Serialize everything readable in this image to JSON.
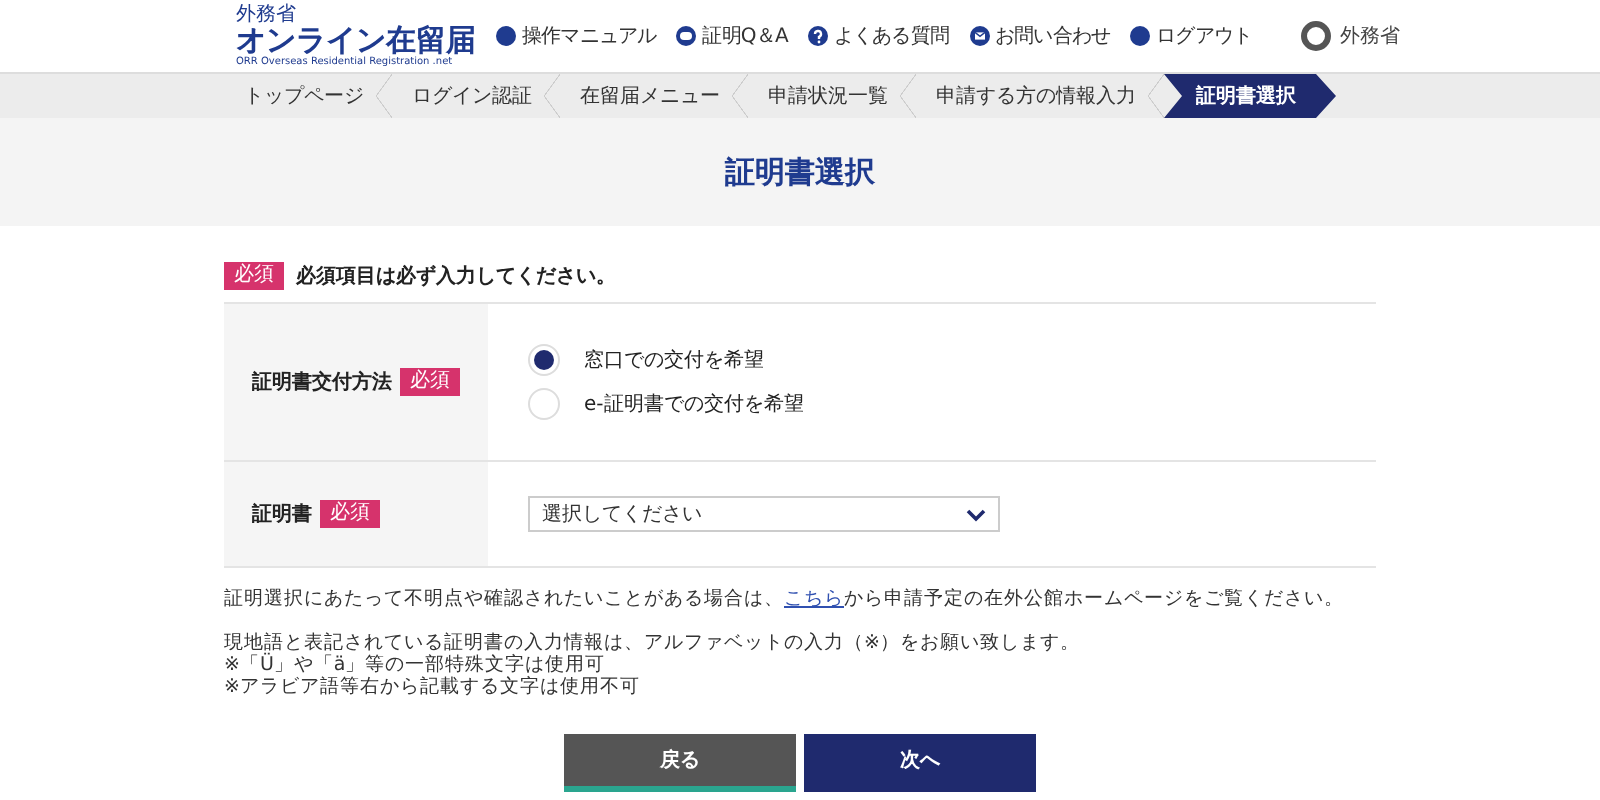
{
  "header": {
    "logo": {
      "top": "外務省",
      "main": "オンライン在留届",
      "sub": "ORR Overseas Residential Registration .net"
    },
    "links": [
      {
        "label": "操作マニュアル",
        "kind": "dot"
      },
      {
        "label": "証明Q＆A",
        "kind": "qa"
      },
      {
        "label": "よくある質問",
        "kind": "help"
      },
      {
        "label": "お問い合わせ",
        "kind": "mail"
      },
      {
        "label": "ログアウト",
        "kind": "dot"
      }
    ],
    "ministry": "外務省"
  },
  "breadcrumbs": [
    {
      "label": "トップページ",
      "selected": false
    },
    {
      "label": "ログイン認証",
      "selected": false
    },
    {
      "label": "在留届メニュー",
      "selected": false
    },
    {
      "label": "申請状況一覧",
      "selected": false
    },
    {
      "label": "申請する方の情報入力",
      "selected": false
    },
    {
      "label": "証明書選択",
      "selected": true
    }
  ],
  "page_title": "証明書選択",
  "required_note": {
    "badge": "必須",
    "text": "必須項目は必ず入力してください。"
  },
  "form": {
    "rows": [
      {
        "kind": "radio",
        "label": "証明書交付方法",
        "badge": "必須",
        "options": [
          {
            "label": "窓口での交付を希望",
            "selected": true
          },
          {
            "label": "e-証明書での交付を希望",
            "selected": false
          }
        ]
      },
      {
        "kind": "select",
        "label": "証明書",
        "badge": "必須",
        "value": "選択してください"
      }
    ]
  },
  "notes": {
    "inquiry": {
      "before": "証明選択にあたって不明点や確認されたいことがある場合は、",
      "link": "こちら",
      "after": "から申請予定の在外公館ホームページをご覧ください。"
    },
    "lines": [
      "現地語と表記されている証明書の入力情報は、アルファベットの入力（※）をお願い致します。",
      "※「Ü」や「ä」等の一部特殊文字は使用可",
      "※アラビア語等右から記載する文字は使用不可"
    ]
  },
  "buttons": [
    {
      "label": "戻る",
      "kind": "back"
    },
    {
      "label": "次へ",
      "kind": "next"
    }
  ]
}
